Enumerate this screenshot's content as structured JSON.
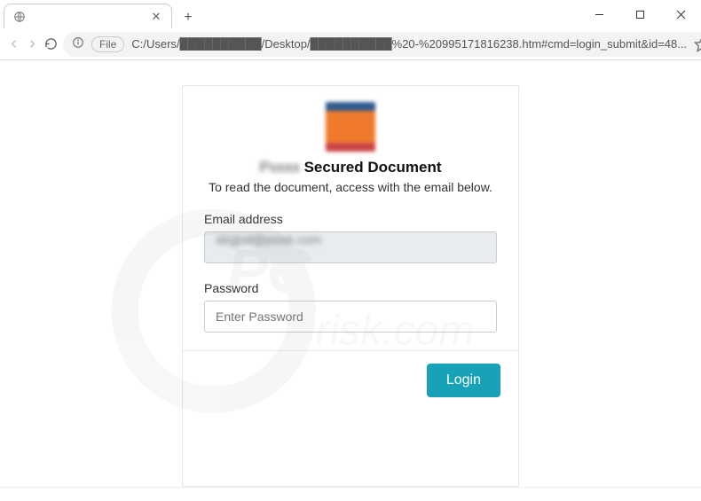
{
  "window": {
    "tab": {
      "label": " "
    },
    "controls": {
      "minimize": "minimize",
      "maximize": "maximize",
      "close": "close"
    }
  },
  "toolbar": {
    "file_chip": "File",
    "url_display": "C:/Users/██████████/Desktop/██████████%20-%20995171816238.htm#cmd=login_submit&id=48..."
  },
  "page": {
    "brand_prefix": "Pxxxx",
    "headline_main": "Secured Document",
    "subheadline": "To read the document, access with the email below.",
    "email_label": "Email address",
    "email_value_masked": "abgjud@psisk.com",
    "password_label": "Password",
    "password_placeholder": "Enter Password",
    "login_button": "Login"
  },
  "watermark": {
    "line1": "PC",
    "line2": "risk.com"
  },
  "colors": {
    "login_button_bg": "#17a2b8",
    "logo_top": "#2e5b8f",
    "logo_mid": "#ef7a2b"
  }
}
